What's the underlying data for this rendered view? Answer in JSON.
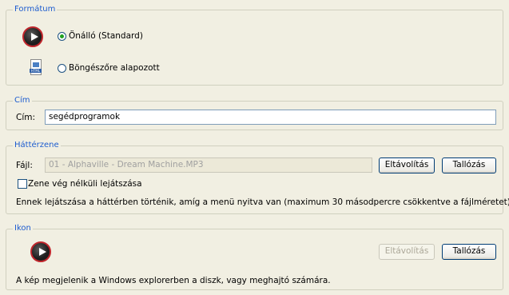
{
  "format": {
    "title": "Formátum",
    "option_standalone": "Önálló (Standard)",
    "option_browser": "Böngészőre alapozott",
    "icon_browser_tag": "HTML"
  },
  "title_section": {
    "title": "Cím",
    "field_label": "Cím:",
    "field_value": "segédprogramok"
  },
  "background_music": {
    "title": "Háttérzene",
    "file_label": "Fájl:",
    "file_value": "01 - Alphaville - Dream Machine.MP3",
    "remove_button": "Eltávolítás",
    "browse_button": "Tallózás",
    "loop_checkbox_label": "Zene vég nélküli lejátszása",
    "info_text": "Ennek lejátszása a háttérben történik, amíg a menü nyitva van (maximum 30 másodpercre csökkentve a fájlméretet)."
  },
  "icon_section": {
    "title": "Ikon",
    "remove_button": "Eltávolítás",
    "browse_button": "Tallózás",
    "info_text": "A kép megjelenik a Windows explorerben a diszk, vagy meghajtó számára."
  }
}
